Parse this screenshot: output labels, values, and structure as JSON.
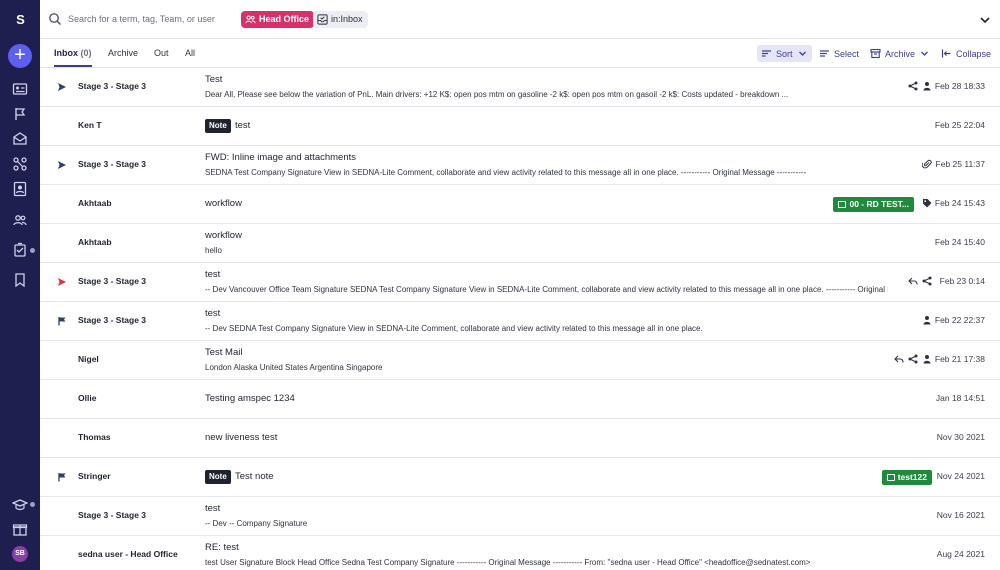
{
  "sidebar": {
    "logo": "S",
    "new_label": "+",
    "avatar_initials": "SB"
  },
  "search": {
    "placeholder": "Search for a term, tag, Team, or user",
    "chip_team": "Head Office",
    "chip_inbox": "in:Inbox"
  },
  "tabs": [
    {
      "label": "Inbox",
      "count": "(0)"
    },
    {
      "label": "Archive"
    },
    {
      "label": "Out"
    },
    {
      "label": "All"
    }
  ],
  "toolbar": {
    "sort": "Sort",
    "select": "Select",
    "archive": "Archive",
    "collapse": "Collapse"
  },
  "colors": {
    "sidebar_bg": "#1e1f4e",
    "accent": "#3b3d8f",
    "team_chip": "#d6316a",
    "tag_green": "#1f8a3b",
    "flag_red": "#e0323c"
  },
  "messages": [
    {
      "flag": "sent",
      "sender": "Stage 3 - Stage 3",
      "subject": "Test",
      "preview": "Dear All, Please see below the variation of PnL. Main drivers: +12 K$: open pos mtm on gasoline -2 k$: open pos mtm on gasoil -2 k$: Costs updated - breakdown ...",
      "date": "Feb 28 18:33",
      "icons": [
        "share-icon",
        "person-icon"
      ]
    },
    {
      "flag": "",
      "sender": "Ken T",
      "note": "Note",
      "subject": "test",
      "date": "Feb 25 22:04"
    },
    {
      "flag": "sent",
      "sender": "Stage 3 - Stage 3",
      "subject": "FWD: Inline image and attachments",
      "preview": "SEDNA Test Company Signature View in SEDNA-Lite Comment, collaborate and view activity related to this message all in one place. ----------- Original Message -----------",
      "date": "Feb 25 11:37",
      "icons": [
        "paperclip-icon"
      ]
    },
    {
      "flag": "",
      "sender": "Akhtaab",
      "subject": "workflow",
      "tag": "00 - RD TEST...",
      "date": "Feb 24 15:43",
      "icons": [
        "tag-icon"
      ]
    },
    {
      "flag": "",
      "sender": "Akhtaab",
      "subject": "workflow",
      "preview": "hello",
      "date": "Feb 24 15:40"
    },
    {
      "flag": "sent-red",
      "sender": "Stage 3 - Stage 3",
      "subject": "test",
      "preview": "-- Dev Vancouver Office Team Signature SEDNA Test Company Signature View in SEDNA-Lite Comment, collaborate and view activity related to this message all in one place. ----------- Original Message -----------",
      "date": "Feb 23 0:14",
      "icons": [
        "reply-icon",
        "share-icon"
      ]
    },
    {
      "flag": "flagged",
      "sender": "Stage 3 - Stage 3",
      "subject": "test",
      "preview": "-- Dev SEDNA Test Company Signature View in SEDNA-Lite Comment, collaborate and view activity related to this message all in one place.",
      "date": "Feb 22 22:37",
      "icons": [
        "person-icon"
      ]
    },
    {
      "flag": "",
      "sender": "Nigel",
      "subject": "Test Mail",
      "preview": "London Alaska United States Argentina Singapore",
      "date": "Feb 21 17:38",
      "icons": [
        "reply-icon",
        "share-icon",
        "person-icon"
      ]
    },
    {
      "flag": "",
      "sender": "Ollie",
      "subject": "Testing amspec 1234",
      "date": "Jan 18 14:51"
    },
    {
      "flag": "",
      "sender": "Thomas",
      "subject": "new liveness test",
      "date": "Nov 30 2021"
    },
    {
      "flag": "flagged",
      "sender": "Stringer",
      "note": "Note",
      "subject": "Test note",
      "tag": "test122",
      "date": "Nov 24 2021"
    },
    {
      "flag": "",
      "sender": "Stage 3 - Stage 3",
      "subject": "test",
      "preview": "-- Dev -- Company Signature",
      "date": "Nov 16 2021"
    },
    {
      "flag": "",
      "sender": "sedna user - Head Office",
      "subject": "RE: test",
      "preview": "test User Signature Block Head Office Sedna Test Company Signature ----------- Original Message ----------- From: \"sedna user - Head Office\" <headoffice@sednatest.com>",
      "date": "Aug 24 2021"
    }
  ]
}
